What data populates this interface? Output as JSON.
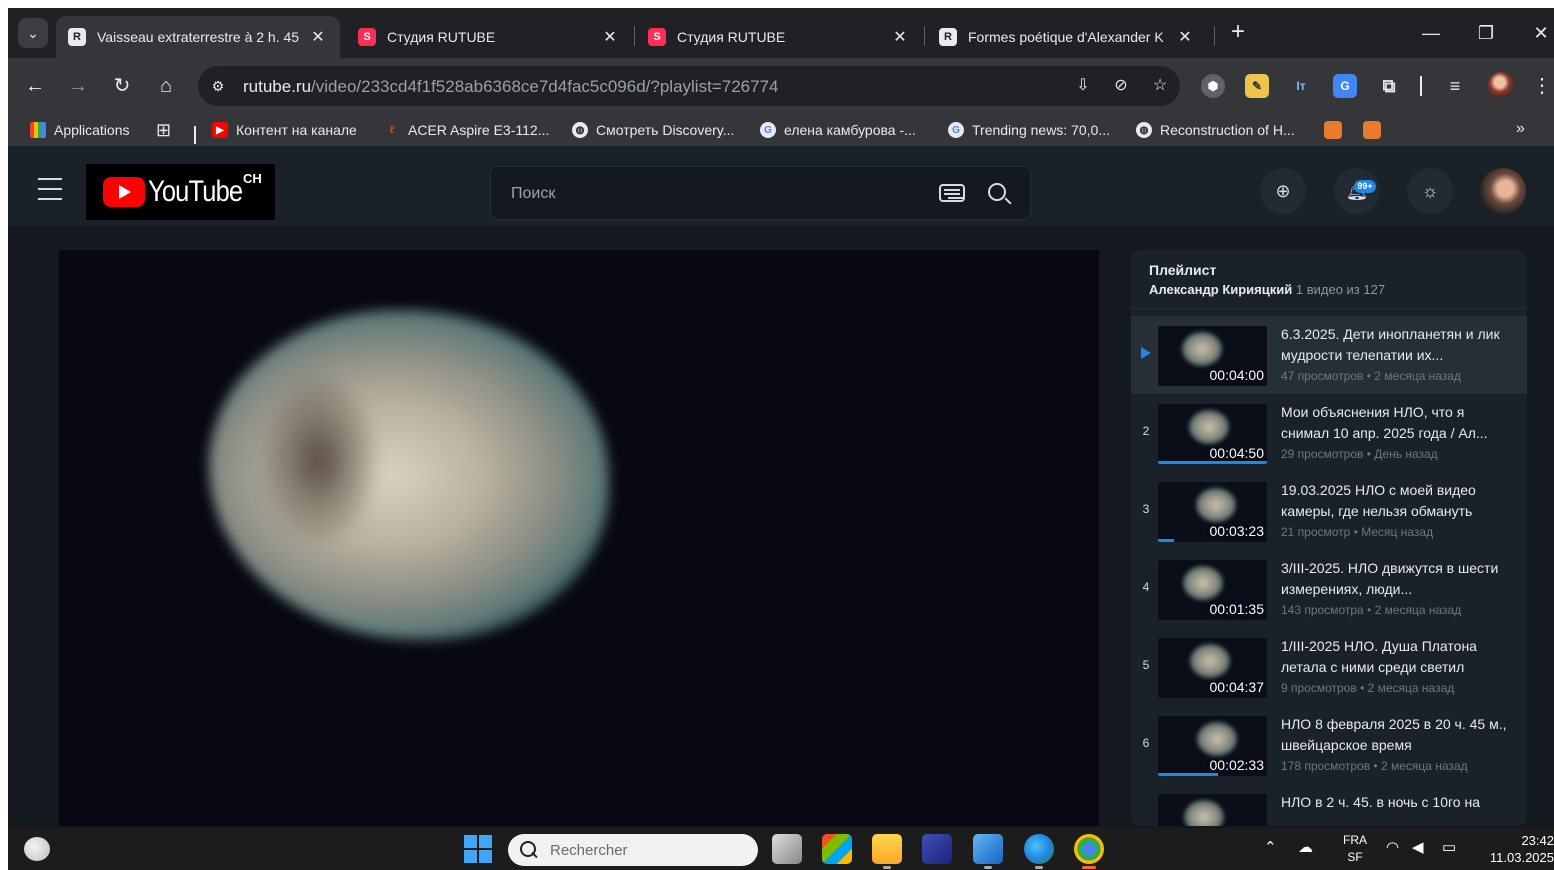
{
  "browser": {
    "tabs": [
      {
        "title": "Vaisseau extraterrestre à 2 h. 45",
        "favicon": "R",
        "active": true
      },
      {
        "title": "Студия RUTUBE",
        "favicon": "S",
        "active": false
      },
      {
        "title": "Студия RUTUBE",
        "favicon": "S",
        "active": false
      },
      {
        "title": "Formes poétique d'Alexander K",
        "favicon": "R",
        "active": false
      }
    ],
    "new_tab_label": "+",
    "url_host": "rutube.ru",
    "url_path": "/video/233cd4f1f528ab6368ce7d4fac5c096d/?playlist=726774",
    "bookmarks": [
      {
        "label": "Applications",
        "icon": "apps-grid-icon"
      },
      {
        "label": "Контент на канале",
        "icon": "youtube-icon"
      },
      {
        "label": "ACER Aspire E3-112...",
        "icon": "acer-icon"
      },
      {
        "label": "Смотреть Discovery...",
        "icon": "globe-icon"
      },
      {
        "label": "елена камбурова -...",
        "icon": "google-icon"
      },
      {
        "label": "Trending news: 70,0...",
        "icon": "google-icon"
      },
      {
        "label": "Reconstruction of H...",
        "icon": "globe-icon"
      }
    ],
    "more_bookmarks": "»"
  },
  "site": {
    "logo_text": "YouTube",
    "logo_badge": "CH",
    "search_placeholder": "Поиск"
  },
  "playlist": {
    "title": "Плейлист",
    "author": "Александр Кирияцкий",
    "count": "1 видео из 127",
    "items": [
      {
        "num": "",
        "title": "6.3.2025. Дети инопланетян и лик мудрости телепатии их...",
        "meta": "47 просмотров • 2 месяца назад",
        "duration": "00:04:00",
        "active": true,
        "progress": 0
      },
      {
        "num": "2",
        "title": "Мои объяснения НЛО, что я снимал 10 апр. 2025 года / Ал...",
        "meta": "29 просмотров • День назад",
        "duration": "00:04:50",
        "active": false,
        "progress": 1.0
      },
      {
        "num": "3",
        "title": "19.03.2025 НЛО с моей видео камеры, где нельзя обмануть",
        "meta": "21 просмотр • Месяц назад",
        "duration": "00:03:23",
        "active": false,
        "progress": 0.15
      },
      {
        "num": "4",
        "title": "3/III-2025. НЛО движутся в шести измерениях, люди...",
        "meta": "143 просмотра • 2 месяца назад",
        "duration": "00:01:35",
        "active": false,
        "progress": 0
      },
      {
        "num": "5",
        "title": "1/III-2025 НЛО. Душа Платона летала с ними среди светил",
        "meta": "9 просмотров • 2 месяца назад",
        "duration": "00:04:37",
        "active": false,
        "progress": 0
      },
      {
        "num": "6",
        "title": "НЛО 8 февраля 2025 в 20 ч. 45 м., швейцарское время",
        "meta": "178 просмотров • 2 месяца назад",
        "duration": "00:02:33",
        "active": false,
        "progress": 0.55
      },
      {
        "num": "",
        "title": "НЛО в 2 ч. 45. в ночь с 10го на",
        "meta": "",
        "duration": "",
        "active": false,
        "progress": 0
      }
    ]
  },
  "taskbar": {
    "search_placeholder": "Rechercher",
    "lang_top": "FRA",
    "lang_bottom": "SF",
    "time": "23:42",
    "date": "11.03.2025"
  }
}
